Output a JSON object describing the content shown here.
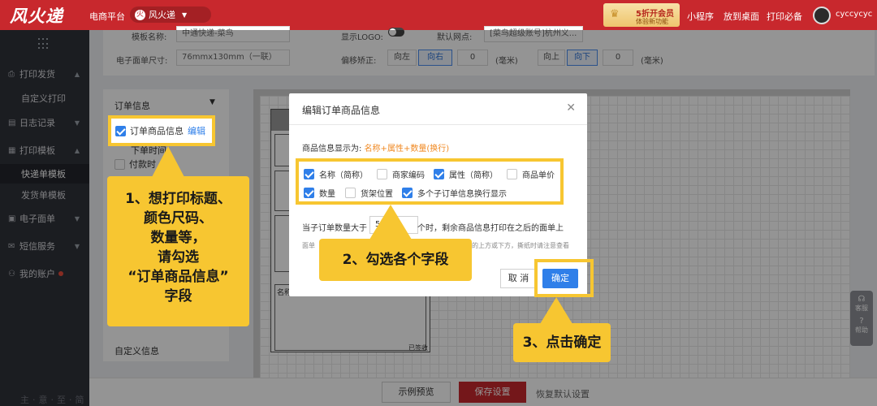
{
  "topbar": {
    "logo": "风火递",
    "platform": "电商平台",
    "store": "风火递",
    "promo_line1": "5折开会员",
    "promo_line2": "体验新功能",
    "nav": [
      "小程序",
      "放到桌面",
      "打印必备"
    ],
    "username": "cyccycyc"
  },
  "sidebar": {
    "items": [
      {
        "label": "打印发货",
        "icon": "printer-icon"
      },
      {
        "label": "自定义打印",
        "icon": ""
      },
      {
        "label": "日志记录",
        "icon": "doc-icon"
      },
      {
        "label": "打印模板",
        "icon": "template-icon"
      },
      {
        "label": "快递单模板",
        "icon": ""
      },
      {
        "label": "发货单模板",
        "icon": ""
      },
      {
        "label": "电子面单",
        "icon": "waybill-icon"
      },
      {
        "label": "短信服务",
        "icon": "mail-icon"
      },
      {
        "label": "我的账户",
        "icon": "user-icon"
      }
    ],
    "brand": "主·意·至·简"
  },
  "settings": {
    "template_name_label": "模板名称:",
    "template_name_value": "中通快递-菜鸟",
    "show_logo_label": "显示LOGO:",
    "default_outlet_label": "默认网点:",
    "default_outlet_value": "[菜鸟超级账号]杭州义...",
    "size_label": "电子面单尺寸:",
    "size_value": "76mmx130mm（一联）",
    "offset_label": "偏移矫正:",
    "left": "向左",
    "right": "向右",
    "h_value": "0",
    "unit": "(毫米)",
    "up": "向上",
    "down": "向下",
    "v_value": "0"
  },
  "config_panel": {
    "order_info": "订单信息",
    "order_goods": "订单商品信息",
    "edit": "编辑",
    "order_time": "下单时间",
    "pay_time": "付款时",
    "custom_info": "自定义信息"
  },
  "label_preview": {
    "name_field": "名称",
    "signed": "已签收"
  },
  "bottombar": {
    "preview": "示例预览",
    "save": "保存设置",
    "restore": "恢复默认设置"
  },
  "float_tools": {
    "service": "客服",
    "help": "帮助"
  },
  "modal": {
    "title": "编辑订单商品信息",
    "display_prefix": "商品信息显示为:",
    "display_value": "名称+属性+数量(换行)",
    "options": [
      {
        "label": "名称（简称）",
        "checked": true
      },
      {
        "label": "商家编码",
        "checked": false
      },
      {
        "label": "属性（简称）",
        "checked": true
      },
      {
        "label": "商品单价",
        "checked": false
      },
      {
        "label": "数量",
        "checked": true
      },
      {
        "label": "货架位置",
        "checked": false
      },
      {
        "label": "多个子订单信息换行显示",
        "checked": true
      }
    ],
    "sub_prefix": "当子订单数量大于",
    "sub_value": "5",
    "sub_suffix": "个时，剩余商品信息打印在之后的面单上",
    "note_left": "面单",
    "note_right": "的上方或下方，撕纸时请注意查看",
    "cancel": "取 消",
    "ok": "确定"
  },
  "callouts": {
    "step1": [
      "1、想打印标题、",
      "颜色尺码、",
      "数量等，",
      "请勾选",
      "“订单商品信息”",
      "字段"
    ],
    "step2": "2、勾选各个字段",
    "step3": "3、点击确定"
  },
  "colors": {
    "brand_red": "#c8282d",
    "primary_blue": "#2f7fe9",
    "highlight_yellow": "#f7c631",
    "orange_text": "#f08a24"
  }
}
